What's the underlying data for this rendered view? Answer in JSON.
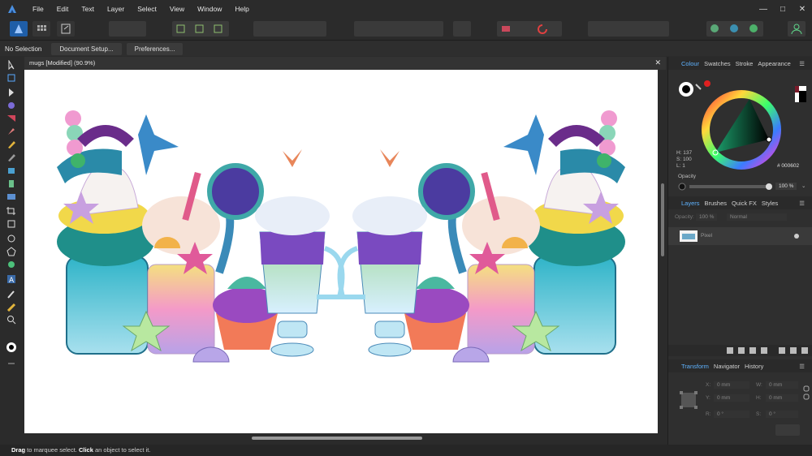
{
  "menu": [
    "File",
    "Edit",
    "Text",
    "Layer",
    "Select",
    "View",
    "Window",
    "Help"
  ],
  "window_controls": [
    "—",
    "□",
    "✕"
  ],
  "context": {
    "selection": "No Selection",
    "doc_setup": "Document Setup...",
    "preferences": "Preferences..."
  },
  "document": {
    "tab_title": "mugs [Modified] (90.9%)"
  },
  "status": {
    "drag": "Drag",
    "drag_text": " to marquee select. ",
    "click": "Click",
    "click_text": " an object to select it."
  },
  "colour_panel": {
    "tabs": [
      "Colour",
      "Swatches",
      "Stroke",
      "Appearance"
    ],
    "h": "H: 137",
    "s": "S: 100",
    "l": "L: 1",
    "hex": "000602",
    "opacity_label": "Opacity",
    "opacity_value": "100 %",
    "accent": "#5fb3ff"
  },
  "layers_panel": {
    "tabs": [
      "Layers",
      "Brushes",
      "Quick FX",
      "Styles"
    ],
    "opacity_label": "Opacity:",
    "opacity_value": "100 %",
    "blend": "Normal",
    "layer_name": "Pixel"
  },
  "transform_panel": {
    "tabs": [
      "Transform",
      "Navigator",
      "History"
    ],
    "x_label": "X:",
    "x_value": "0 mm",
    "y_label": "Y:",
    "y_value": "0 mm",
    "w_label": "W:",
    "w_value": "0 mm",
    "h_label": "H:",
    "h_value": "0 mm",
    "r_label": "R:",
    "r_value": "0 °",
    "s_label": "S:",
    "s_value": "0 °"
  }
}
